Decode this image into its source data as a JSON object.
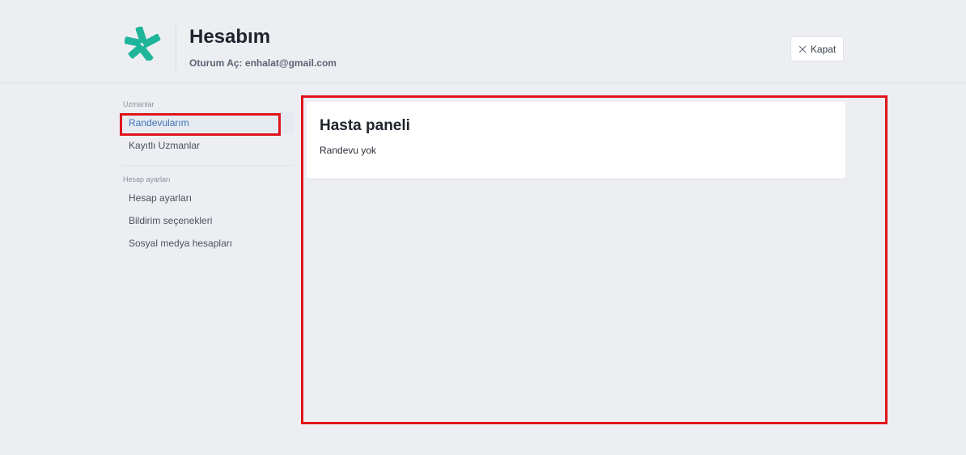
{
  "header": {
    "title": "Hesabım",
    "subtitle": "Oturum Aç: enhalat@gmail.com",
    "close_label": "Kapat",
    "logo_icon": "doctor-star-logo",
    "brand_color": "#1fb59a"
  },
  "sidebar": {
    "sections": [
      {
        "label": "Uzmanlar",
        "items": [
          {
            "label": "Randevularım",
            "active": true
          },
          {
            "label": "Kayıtlı Uzmanlar",
            "active": false
          }
        ]
      },
      {
        "label": "Hesap ayarları",
        "items": [
          {
            "label": "Hesap ayarları",
            "active": false
          },
          {
            "label": "Bildirim seçenekleri",
            "active": false
          },
          {
            "label": "Sosyal medya hesapları",
            "active": false
          }
        ]
      }
    ]
  },
  "main": {
    "card_title": "Hasta paneli",
    "card_text": "Randevu yok"
  },
  "colors": {
    "background": "#eceef2",
    "active_link": "#3d72b4",
    "annotation": "#e0141b"
  }
}
